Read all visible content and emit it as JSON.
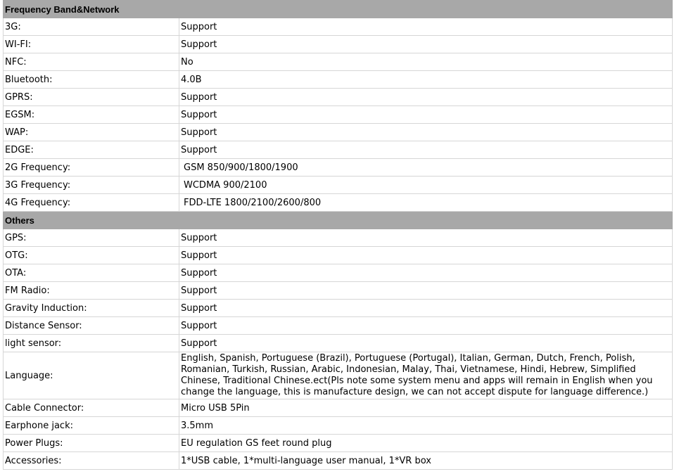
{
  "sections": [
    {
      "title": "Frequency Band&Network",
      "rows": [
        {
          "label": "3G:",
          "value": "Support"
        },
        {
          "label": "WI-FI:",
          "value": "Support"
        },
        {
          "label": "NFC:",
          "value": "No"
        },
        {
          "label": "Bluetooth:",
          "value": "4.0B"
        },
        {
          "label": "GPRS:",
          "value": "Support"
        },
        {
          "label": "EGSM:",
          "value": "Support"
        },
        {
          "label": "WAP:",
          "value": "Support"
        },
        {
          "label": "EDGE:",
          "value": "Support"
        },
        {
          "label": "2G Frequency:",
          "value": "GSM 850/900/1800/1900"
        },
        {
          "label": "3G Frequency:",
          "value": "WCDMA 900/2100"
        },
        {
          "label": "4G Frequency:",
          "value": "FDD-LTE 1800/2100/2600/800"
        }
      ]
    },
    {
      "title": "Others",
      "rows": [
        {
          "label": "GPS:",
          "value": "Support"
        },
        {
          "label": "OTG:",
          "value": "Support"
        },
        {
          "label": "OTA:",
          "value": "Support"
        },
        {
          "label": "FM Radio:",
          "value": "Support"
        },
        {
          "label": "Gravity Induction:",
          "value": "Support"
        },
        {
          "label": "Distance Sensor:",
          "value": "Support"
        },
        {
          "label": "light sensor:",
          "value": "Support"
        },
        {
          "label": "Language:",
          "value": "English, Spanish, Portuguese (Brazil), Portuguese (Portugal), Italian, German, Dutch, French, Polish, Romanian, Turkish, Russian, Arabic, Indonesian, Malay, Thai, Vietnamese, Hindi, Hebrew, Simplified Chinese, Traditional Chinese.ect(Pls note some system menu and apps will remain in English when you change the language, this is manufacture design, we can not accept dispute for language difference.)"
        },
        {
          "label": "Cable Connector:",
          "value": "Micro USB 5Pin"
        },
        {
          "label": "Earphone jack:",
          "value": "3.5mm"
        },
        {
          "label": "Power Plugs:",
          "value": "EU regulation GS feet round plug"
        },
        {
          "label": "Accessories:",
          "value": "1*USB cable, 1*multi-language user manual,  1*VR box"
        }
      ]
    }
  ]
}
